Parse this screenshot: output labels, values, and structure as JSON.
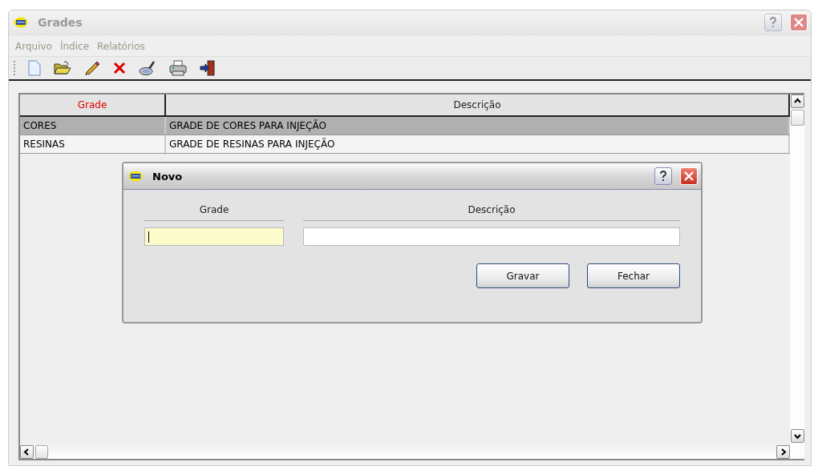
{
  "window": {
    "title": "Grades",
    "active": false
  },
  "menu": [
    {
      "label": "Arquivo"
    },
    {
      "label": "Índice"
    },
    {
      "label": "Relatórios"
    }
  ],
  "toolbar": [
    {
      "kind": "new"
    },
    {
      "kind": "open"
    },
    {
      "kind": "edit"
    },
    {
      "kind": "delete"
    },
    {
      "kind": "search"
    },
    {
      "kind": "print"
    },
    {
      "kind": "exit"
    }
  ],
  "table": {
    "columns": [
      {
        "label": "Grade",
        "sorted": true
      },
      {
        "label": "Descrição",
        "sorted": false
      }
    ],
    "rows": [
      {
        "cells": [
          "CORES",
          "GRADE DE CORES PARA INJEÇÃO"
        ],
        "selected": true
      },
      {
        "cells": [
          "RESINAS",
          "GRADE DE RESINAS PARA INJEÇÃO"
        ],
        "selected": false
      }
    ]
  },
  "dialog": {
    "title": "Novo",
    "active": true,
    "fields": [
      {
        "label": "Grade",
        "focused": true
      },
      {
        "label": "Descrição",
        "focused": false
      }
    ],
    "buttons": [
      {
        "label": "Gravar"
      },
      {
        "label": "Fechar"
      }
    ]
  }
}
